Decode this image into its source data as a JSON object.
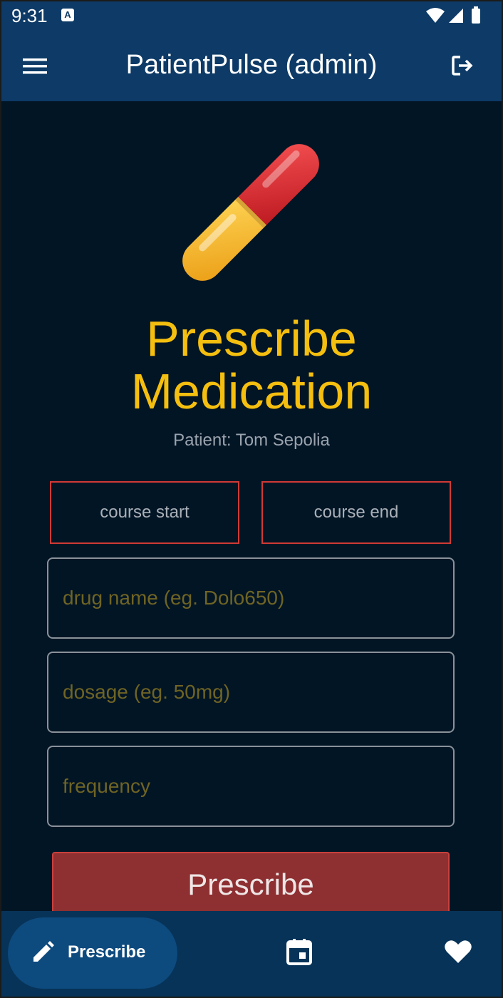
{
  "status_bar": {
    "time": "9:31",
    "keyboard_badge": "A"
  },
  "app_bar": {
    "title": "PatientPulse (admin)"
  },
  "page": {
    "title_line1": "Prescribe",
    "title_line2": "Medication",
    "patient_label": "Patient: Tom Sepolia"
  },
  "course": {
    "start_label": "course start",
    "end_label": "course end"
  },
  "form": {
    "drug_placeholder": "drug name (eg. Dolo650)",
    "dosage_placeholder": "dosage (eg. 50mg)",
    "frequency_placeholder": "frequency",
    "submit_label": "Prescribe"
  },
  "bottom_nav": {
    "items": [
      {
        "label": "Prescribe",
        "icon": "pencil-icon",
        "active": true
      },
      {
        "label": "",
        "icon": "calendar-icon",
        "active": false
      },
      {
        "label": "",
        "icon": "heart-icon",
        "active": false
      }
    ]
  },
  "colors": {
    "appbar": "#0d3a66",
    "background": "#021525",
    "title": "#f5bf0f",
    "accent_red": "#d03a35",
    "button": "#8e2f31",
    "bottom_nav": "#073358"
  }
}
